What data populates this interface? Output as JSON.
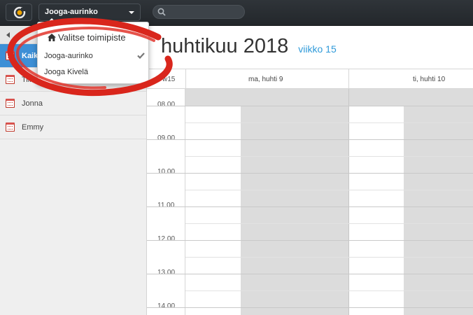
{
  "topbar": {
    "location_selected": "Jooga-aurinko",
    "search_placeholder": ""
  },
  "dropdown": {
    "header": "Valitse toimipiste",
    "items": [
      {
        "label": "Jooga-aurinko",
        "selected": true
      },
      {
        "label": "Jooga Kivelä",
        "selected": false
      }
    ]
  },
  "sidebar": {
    "items": [
      {
        "label": "Kaikki",
        "active": true
      },
      {
        "label": "Tiina",
        "active": false
      },
      {
        "label": "Jonna",
        "active": false
      },
      {
        "label": "Emmy",
        "active": false
      }
    ]
  },
  "calendar": {
    "month_title": "huhtikuu 2018",
    "week_label": "viikko 15",
    "week_col": "w15",
    "days": [
      "ma, huhti 9",
      "ti, huhti 10"
    ],
    "times": [
      "08.00",
      "09.00",
      "10.00",
      "11.00",
      "12.00",
      "13.00",
      "14.00"
    ]
  },
  "colors": {
    "accent": "#3d8fd6",
    "week_link": "#2f9ad9",
    "annotation": "#d9261c"
  }
}
